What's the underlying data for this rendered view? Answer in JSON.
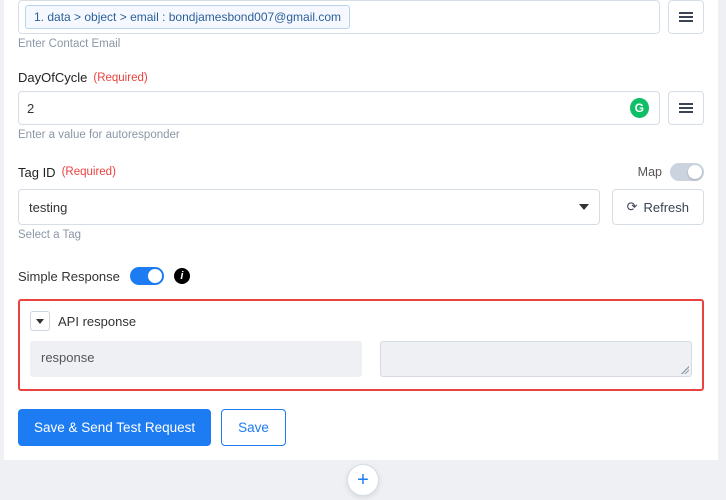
{
  "fields": {
    "contact_email": {
      "pill_label": "1. data > object > email : bondjamesbond007@gmail.com",
      "helper": "Enter Contact Email",
      "menu_icon": "menu-icon"
    },
    "day_of_cycle": {
      "label": "DayOfCycle",
      "required_label": "(Required)",
      "value": "2",
      "helper": "Enter a value for autoresponder",
      "g_badge": "G",
      "menu_icon": "menu-icon"
    },
    "tag_id": {
      "label": "Tag ID",
      "required_label": "(Required)",
      "map_label": "Map",
      "value": "testing",
      "refresh_label": "Refresh",
      "helper": "Select a Tag"
    },
    "simple_response": {
      "label": "Simple Response",
      "info": "i"
    },
    "api_response": {
      "title": "API response",
      "key_value": "response",
      "body_value": ""
    }
  },
  "buttons": {
    "save_send": "Save & Send Test Request",
    "save": "Save",
    "add": "+"
  }
}
